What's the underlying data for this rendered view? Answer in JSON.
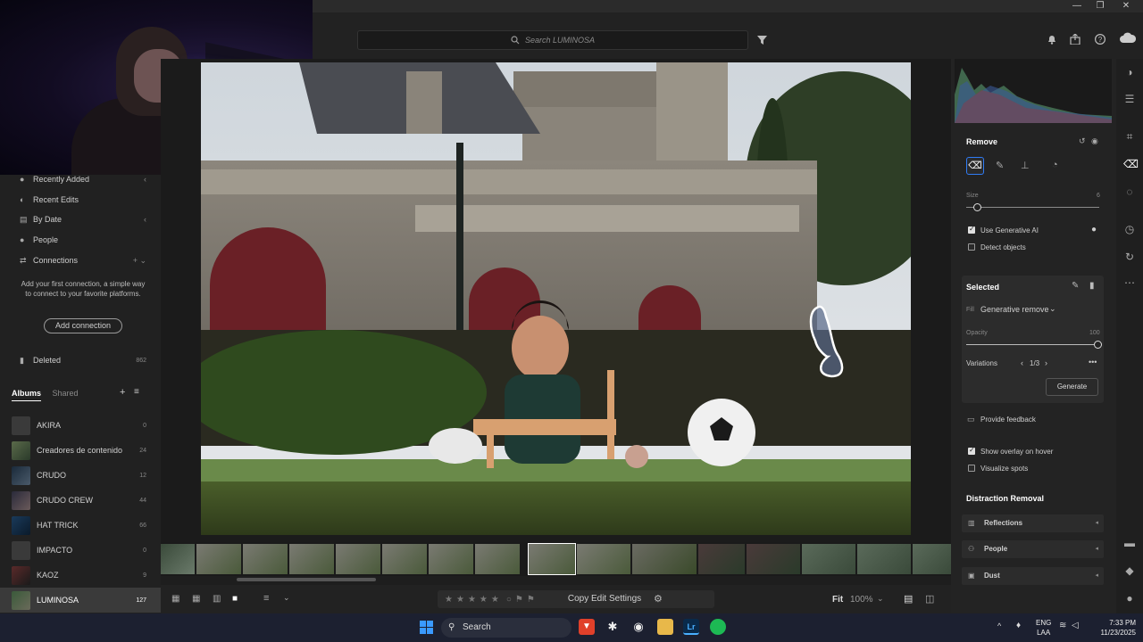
{
  "window": {
    "minimize": "—",
    "maximize": "❐",
    "close": "✕"
  },
  "topbar": {
    "search_placeholder": "Search LUMINOSA"
  },
  "leftnav": {
    "items": [
      {
        "label": "Recently Added",
        "right": "‹"
      },
      {
        "label": "Recent Edits",
        "right": ""
      },
      {
        "label": "By Date",
        "right": "‹"
      },
      {
        "label": "People",
        "right": ""
      },
      {
        "label": "Connections",
        "right": "+ ⌄"
      }
    ],
    "connection_text": "Add your first connection, a simple way to connect to your favorite platforms.",
    "add_connection": "Add connection",
    "deleted": {
      "label": "Deleted",
      "count": "862"
    }
  },
  "album_tabs": {
    "albums": "Albums",
    "shared": "Shared"
  },
  "albums": [
    {
      "name": "AKIRA",
      "count": "0"
    },
    {
      "name": "Creadores de contenido",
      "count": "24"
    },
    {
      "name": "CRUDO",
      "count": "12"
    },
    {
      "name": "CRUDO CREW",
      "count": "44"
    },
    {
      "name": "HAT TRICK",
      "count": "66"
    },
    {
      "name": "IMPACTO",
      "count": "0"
    },
    {
      "name": "KAOZ",
      "count": "9"
    },
    {
      "name": "LUMINOSA",
      "count": "127"
    }
  ],
  "bottombar": {
    "copy_edit": "Copy Edit Settings",
    "fit": "Fit",
    "zoom": "100%"
  },
  "remove_panel": {
    "title": "Remove",
    "size_label": "Size",
    "size_value": "6",
    "size_level": 0.08,
    "use_gen_ai": "Use Generative AI",
    "detect_objects": "Detect objects",
    "selected_title": "Selected",
    "fill_label": "Fill",
    "fill_value": "Generative remove",
    "opacity_label": "Opacity",
    "opacity_value": "100",
    "opacity_level": 1.0,
    "variations_label": "Variations",
    "variations_value": "1/3",
    "generate": "Generate",
    "feedback": "Provide feedback",
    "show_overlay": "Show overlay on hover",
    "visualize_spots": "Visualize spots"
  },
  "distraction": {
    "title": "Distraction Removal",
    "items": [
      {
        "label": "Reflections"
      },
      {
        "label": "People"
      },
      {
        "label": "Dust"
      }
    ]
  },
  "taskbar": {
    "search": "Search",
    "lang1": "ENG",
    "lang2": "LAA",
    "time": "7:33 PM",
    "date": "11/23/2025"
  },
  "colors": {
    "accent": "#2f7bf5",
    "panel": "#232323"
  }
}
